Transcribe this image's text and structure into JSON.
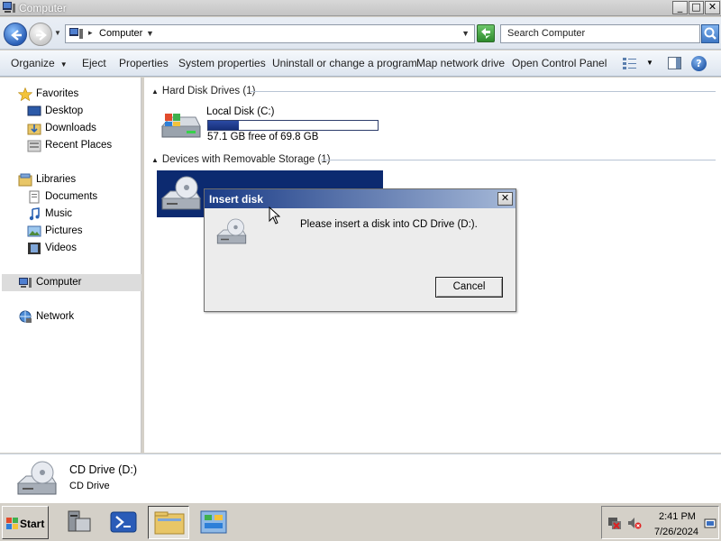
{
  "window": {
    "title": "Computer"
  },
  "window_controls": {
    "minimize": "_",
    "maximize": "□",
    "close": "✕"
  },
  "address": {
    "path": "Computer",
    "search_placeholder": "Search Computer"
  },
  "toolbar": {
    "organize": "Organize",
    "eject": "Eject",
    "properties": "Properties",
    "system_properties": "System properties",
    "uninstall": "Uninstall or change a program",
    "map_drive": "Map network drive",
    "control_panel": "Open Control Panel",
    "help": "?"
  },
  "sidebar": {
    "favorites": {
      "label": "Favorites",
      "items": [
        "Desktop",
        "Downloads",
        "Recent Places"
      ]
    },
    "libraries": {
      "label": "Libraries",
      "items": [
        "Documents",
        "Music",
        "Pictures",
        "Videos"
      ]
    },
    "computer": "Computer",
    "network": "Network"
  },
  "content": {
    "hard_disk_group": "Hard Disk Drives (1)",
    "local_disk": {
      "label": "Local Disk (C:)",
      "free_text": "57.1 GB free of 69.8 GB",
      "used_fraction": 0.18
    },
    "removable_group": "Devices with Removable Storage (1)"
  },
  "details": {
    "name": "CD Drive (D:)",
    "type": "CD Drive"
  },
  "dialog": {
    "title": "Insert disk",
    "close": "✕",
    "message": "Please insert a disk into CD Drive (D:).",
    "cancel": "Cancel"
  },
  "taskbar": {
    "start": "Start",
    "time": "2:41 PM",
    "date": "7/26/2024"
  },
  "colors": {
    "selection": "#0c2a70",
    "dialog_title_start": "#1a3b86",
    "dialog_title_end": "#a6b9d8",
    "disk_fill": "#1e3a8f"
  },
  "icons": {
    "drive": "hard-drive-icon",
    "cd": "cd-drive-icon",
    "computer": "computer-icon",
    "network": "network-icon"
  }
}
